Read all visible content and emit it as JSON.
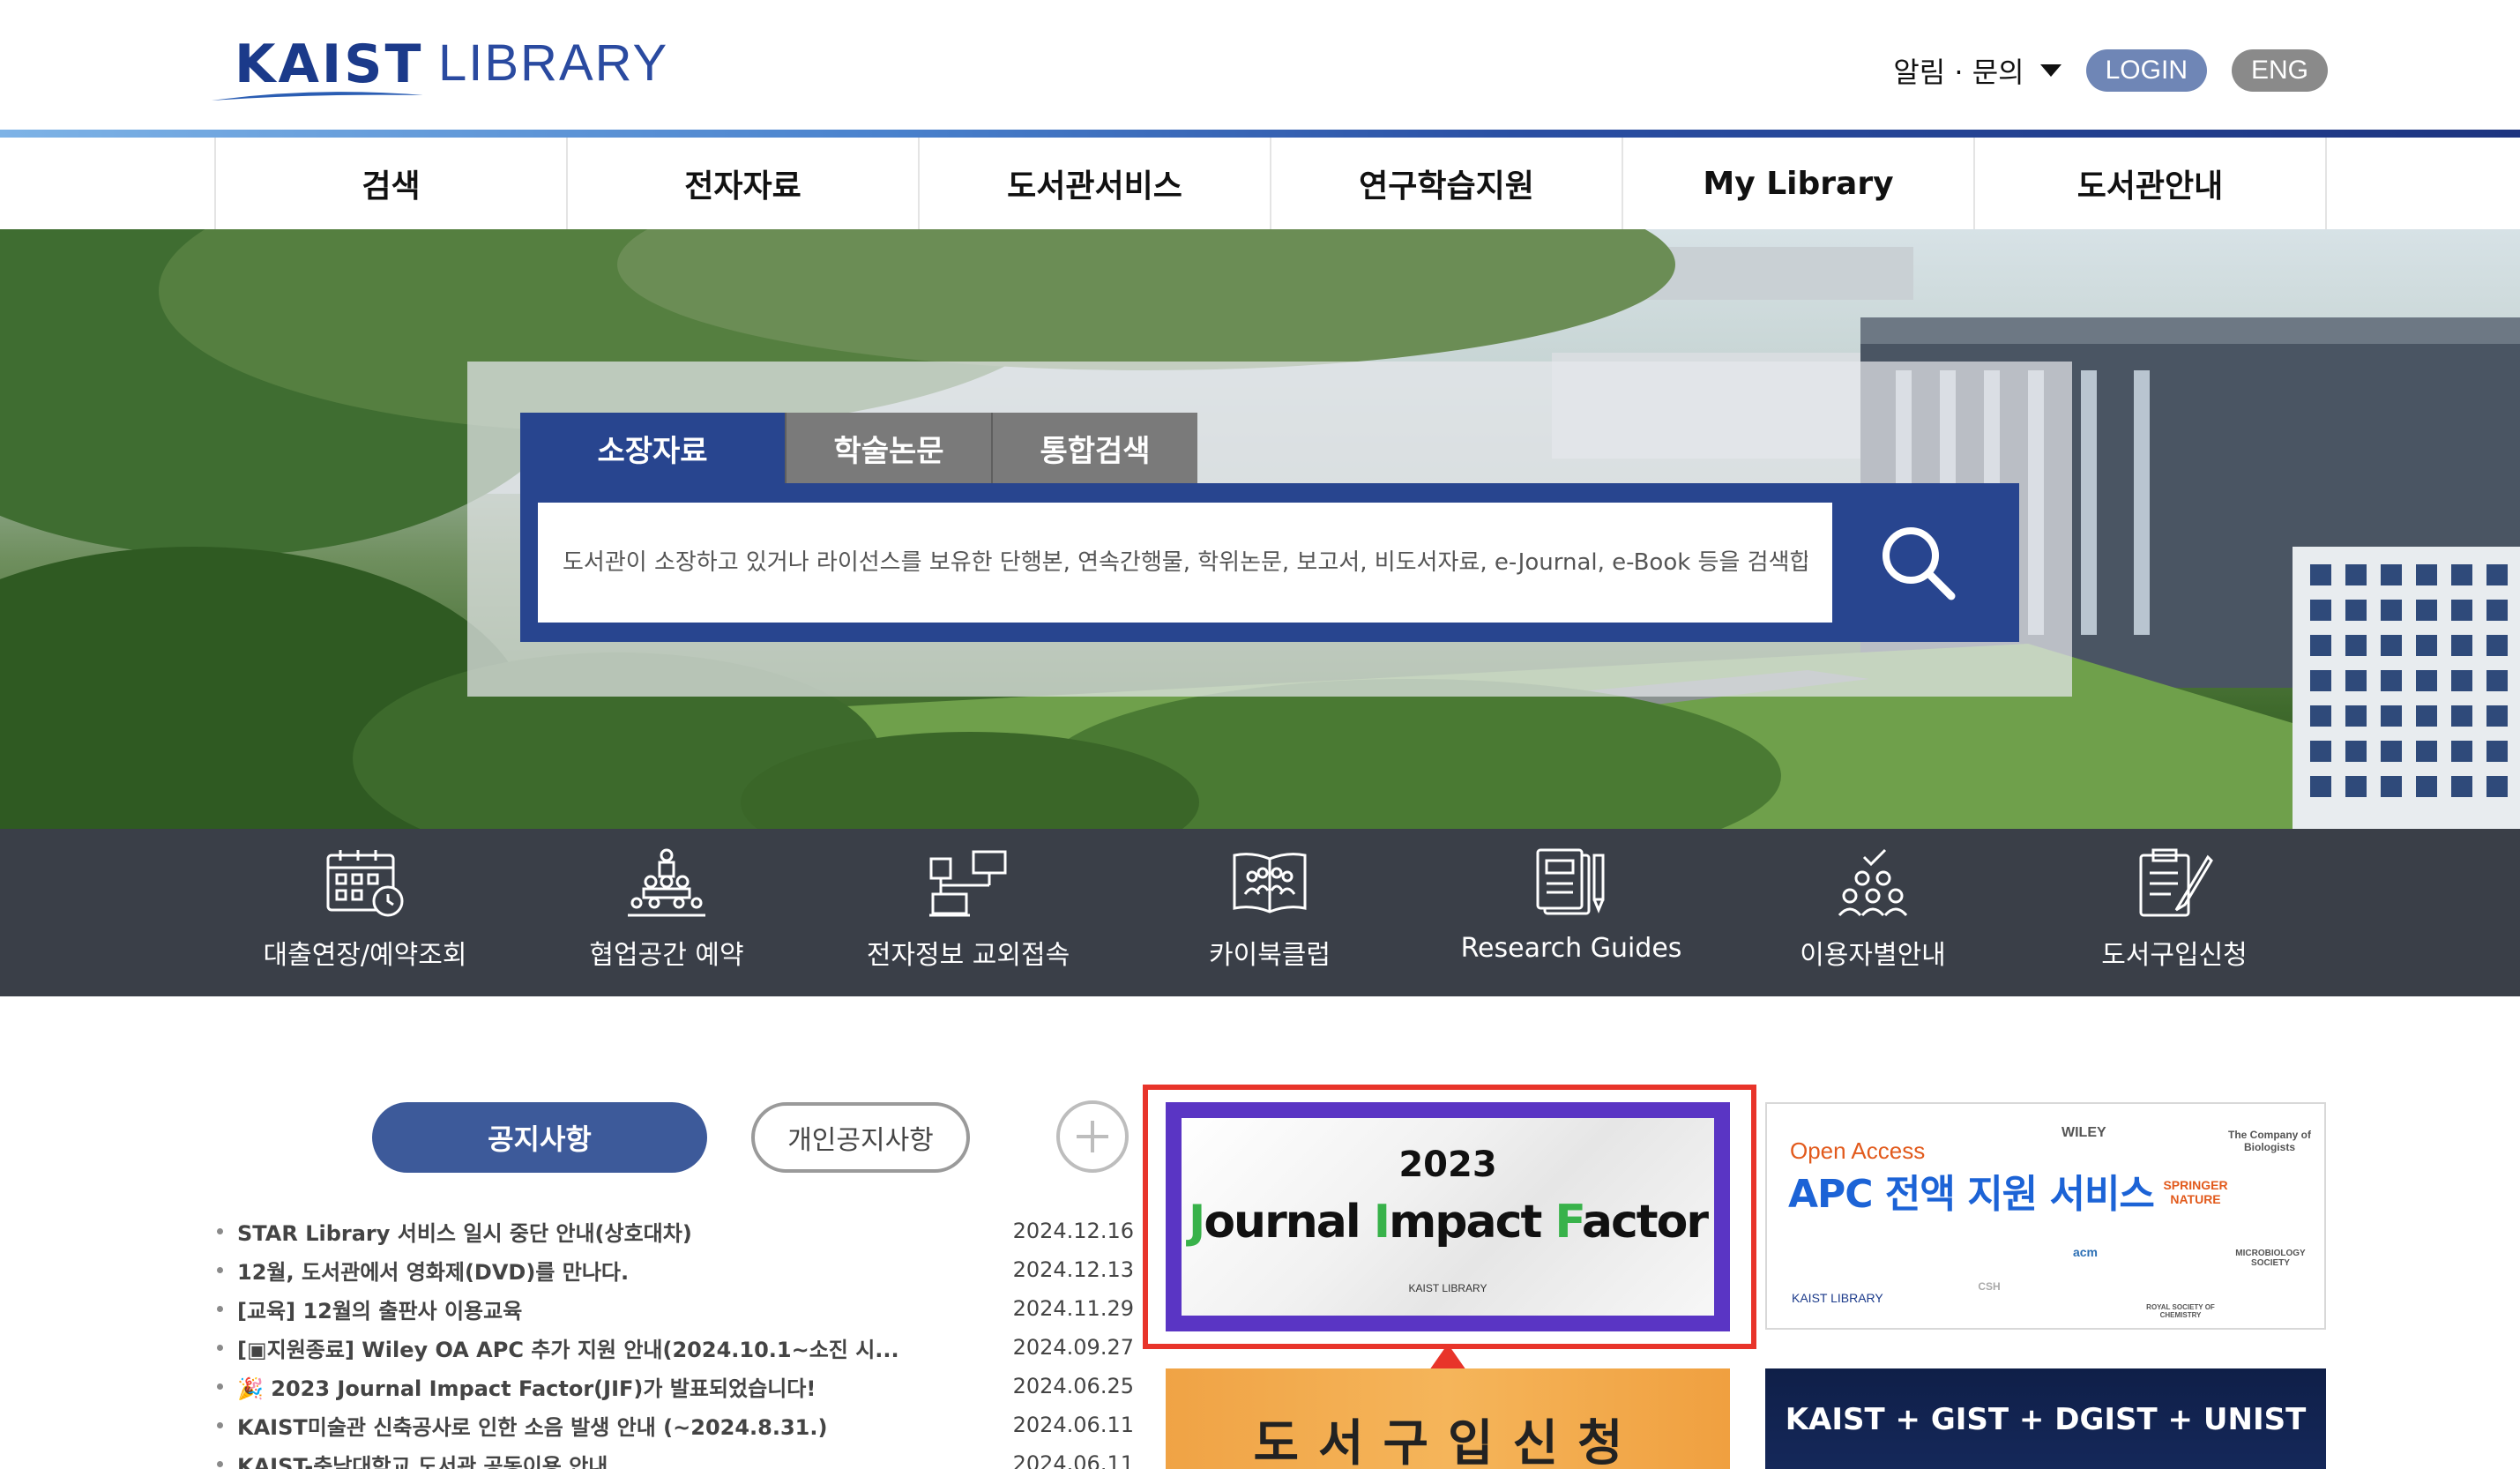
{
  "header": {
    "logo_main": "KAIST",
    "logo_sub": "LIBRARY",
    "notice_menu": "알림 · 문의",
    "login": "LOGIN",
    "lang": "ENG"
  },
  "gnb": [
    "검색",
    "전자자료",
    "도서관서비스",
    "연구학습지원",
    "My Library",
    "도서관안내"
  ],
  "search": {
    "tabs": [
      "소장자료",
      "학술논문",
      "통합검색"
    ],
    "active_tab": "소장자료",
    "placeholder": "도서관이 소장하고 있거나 라이선스를 보유한 단행본, 연속간행물, 학위논문, 보고서, 비도서자료, e-Journal, e-Book 등을 검색합니다"
  },
  "quick_menu": [
    {
      "label": "대출연장/예약조회",
      "icon": "calendar-clock-icon"
    },
    {
      "label": "협업공간 예약",
      "icon": "group-people-icon"
    },
    {
      "label": "전자정보 교외접속",
      "icon": "network-access-icon"
    },
    {
      "label": "카이북클럽",
      "icon": "book-club-icon"
    },
    {
      "label": "Research Guides",
      "icon": "guide-book-icon"
    },
    {
      "label": "이용자별안내",
      "icon": "user-group-check-icon"
    },
    {
      "label": "도서구입신청",
      "icon": "clipboard-pen-icon"
    }
  ],
  "notices": {
    "tabs": [
      "공지사항",
      "개인공지사항"
    ],
    "items": [
      {
        "title": "STAR Library 서비스 일시 중단 안내(상호대차)",
        "date": "2024.12.16"
      },
      {
        "title": "12월, 도서관에서 영화제(DVD)를 만나다.",
        "date": "2024.12.13"
      },
      {
        "title": "[교육] 12월의 출판사 이용교육",
        "date": "2024.11.29"
      },
      {
        "title": "[▣지원종료] Wiley OA APC 추가 지원 안내(2024.10.1~소진 시...",
        "date": "2024.09.27"
      },
      {
        "title": "🎉 2023 Journal Impact Factor(JIF)가 발표되었습니다!",
        "date": "2024.06.25"
      },
      {
        "title": "KAIST미술관 신축공사로 인한 소음 발생 안내 (~2024.8.31.)",
        "date": "2024.06.11"
      },
      {
        "title": "KAIST-충남대학교 도서관 공동이용 안내",
        "date": "2024.06.11"
      }
    ]
  },
  "banners": {
    "jif": {
      "year": "2023",
      "title_parts": [
        "J",
        "ournal ",
        "I",
        "mpact ",
        "F",
        "actor"
      ],
      "logo": "KAIST LIBRARY"
    },
    "apc": {
      "oa": "Open Access",
      "title": "APC 전액 지원 서비스",
      "kaist": "KAIST LIBRARY",
      "publishers": [
        "WILEY",
        "The Company of Biologists",
        "SPRINGER NATURE",
        "acm",
        "MICROBIOLOGY SOCIETY",
        "ROYAL SOCIETY OF CHEMISTRY",
        "CSH"
      ]
    },
    "purchase": {
      "text": "도서구입신청"
    },
    "consortium": {
      "text": "KAIST + GIST + DGIST + UNIST"
    }
  },
  "colors": {
    "brand": "#28458f",
    "highlight": "#e8342a",
    "quick_bg": "#3a3f48"
  }
}
